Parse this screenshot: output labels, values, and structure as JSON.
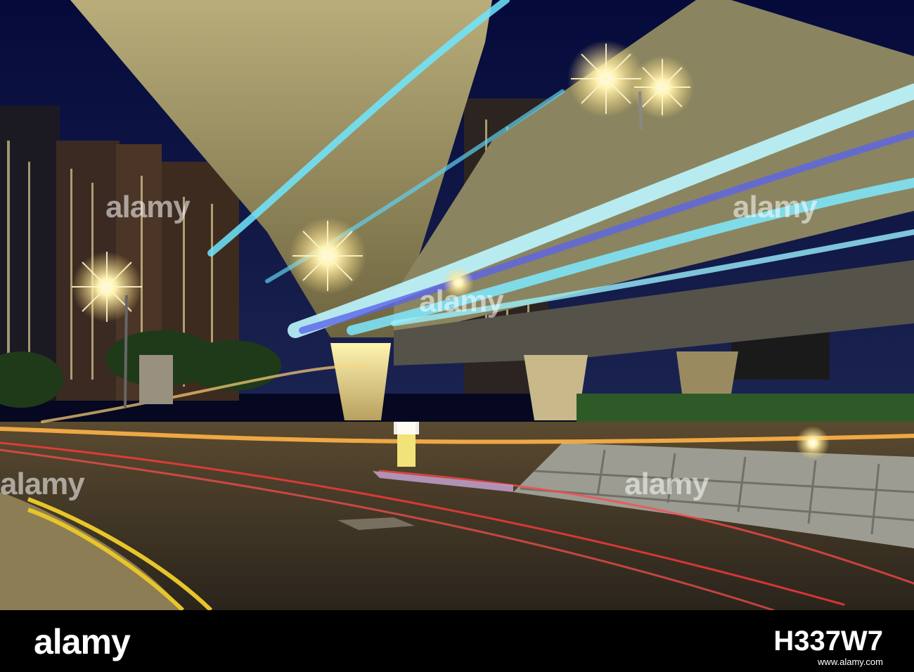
{
  "scene": {
    "subject": "night-traffic-under-flyover",
    "colors": {
      "sky": "#0a1040",
      "light_trail_blue": "#6fe6ff",
      "light_trail_red": "#ff3a3a",
      "streetlight": "#ffe89a",
      "road": "#3a3226"
    }
  },
  "watermark": {
    "overlay_text": "alamy",
    "brand": "alamy",
    "image_code": "H337W7",
    "url": "www.alamy.com"
  }
}
